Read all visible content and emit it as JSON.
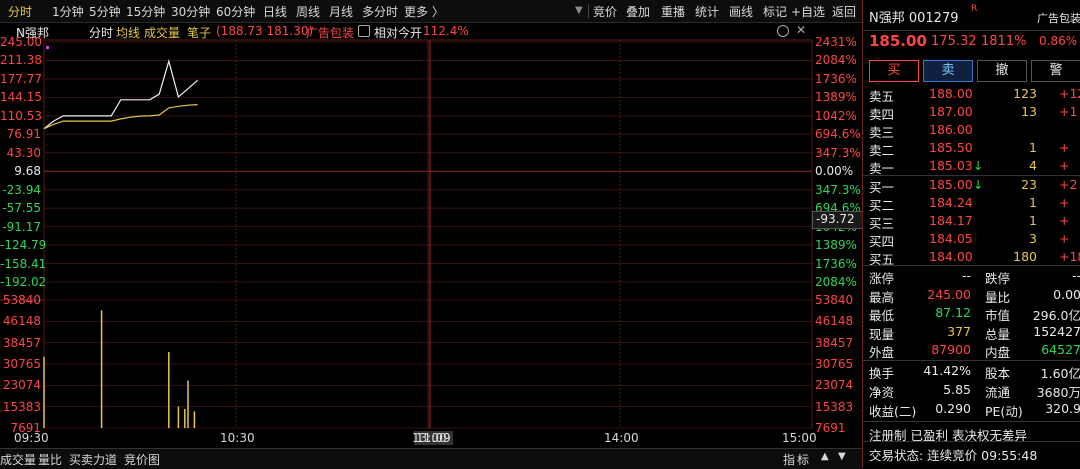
{
  "toolbar": {
    "periods": [
      "分时",
      "1分钟",
      "5分钟",
      "15分钟",
      "30分钟",
      "60分钟",
      "日线",
      "周线",
      "月线",
      "多分时",
      "更多 〉"
    ],
    "actions": [
      "竞价",
      "叠加",
      "重播",
      "统计",
      "画线",
      "标记",
      "+自选",
      "返回"
    ]
  },
  "chart_header": {
    "name": "N强邦",
    "mode": "分时",
    "avg_label": "均线",
    "vol_label": "成交量",
    "pen_label": "笔子",
    "pen_value": "(188.73 181.30)",
    "ad_label": "广告包装",
    "relative_label": "相对今开",
    "relative_value": "112.4%"
  },
  "axis": {
    "left_prices": [
      "245.00",
      "211.38",
      "177.77",
      "144.15",
      "110.53",
      "76.91",
      "43.30",
      "9.68",
      "-23.94",
      "-57.55",
      "-91.17",
      "-124.79",
      "-158.41",
      "-192.02"
    ],
    "right_pcts": [
      "2431%",
      "2084%",
      "1736%",
      "1389%",
      "1042%",
      "694.6%",
      "347.3%",
      "0.00%",
      "347.3%",
      "694.6%",
      "1042%",
      "1389%",
      "1736%",
      "2084%"
    ],
    "cursor_value": "-93.72",
    "vol_ticks": [
      "53840",
      "46148",
      "38457",
      "30765",
      "23074",
      "15383",
      "7691"
    ],
    "time_labels": [
      "09:30",
      "10:30",
      "11:09",
      "13:00",
      "14:00",
      "15:00"
    ]
  },
  "chart_data": {
    "type": "line",
    "series": [
      {
        "x": [
          "09:30",
          "09:33",
          "09:36",
          "09:39",
          "09:42",
          "09:45",
          "09:48",
          "09:51",
          "09:54",
          "09:57",
          "10:00",
          "10:03",
          "10:06",
          "10:09",
          "10:12",
          "10:15",
          "10:18"
        ],
        "values": [
          87.1,
          101.0,
          110.5,
          110.5,
          110.5,
          110.5,
          110.5,
          110.5,
          139.7,
          139.7,
          139.7,
          139.7,
          150.0,
          210.0,
          145.0,
          160.0,
          175.3
        ]
      },
      {
        "x": [
          "09:30",
          "09:33",
          "09:36",
          "09:39",
          "09:42",
          "09:45",
          "09:48",
          "09:51",
          "09:54",
          "09:57",
          "10:00",
          "10:03",
          "10:06",
          "10:09",
          "10:12",
          "10:15",
          "10:18"
        ],
        "values": [
          87.1,
          95.0,
          101.0,
          101.0,
          101.0,
          101.0,
          101.0,
          101.0,
          105.0,
          108.0,
          110.0,
          110.5,
          112.0,
          125.0,
          128.0,
          130.0,
          131.0
        ]
      }
    ],
    "volume": [
      {
        "x": "09:30",
        "v": 30000
      },
      {
        "x": "09:48",
        "v": 49500
      },
      {
        "x": "10:09",
        "v": 32000
      },
      {
        "x": "10:12",
        "v": 9000
      },
      {
        "x": "10:14",
        "v": 8000
      },
      {
        "x": "10:15",
        "v": 20000
      },
      {
        "x": "10:17",
        "v": 7000
      }
    ],
    "ylim": [
      -192.02,
      245.0
    ],
    "vol_max": 53840,
    "xlabel": "",
    "ylabel": ""
  },
  "stock": {
    "title": "N强邦 001279",
    "title_flag": "R",
    "ad": "广告包装",
    "price": "185.00",
    "change": "175.32",
    "pct": "1811%",
    "ad_pct": "0.86%"
  },
  "trade_buttons": [
    "买",
    "卖",
    "撤",
    "警"
  ],
  "sell": [
    {
      "label": "卖五",
      "price": "188.00",
      "vol": "123",
      "chg": "+12"
    },
    {
      "label": "卖四",
      "price": "187.00",
      "vol": "13",
      "chg": "+1"
    },
    {
      "label": "卖三",
      "price": "186.00",
      "vol": "",
      "chg": ""
    },
    {
      "label": "卖二",
      "price": "185.50",
      "vol": "1",
      "chg": "+"
    },
    {
      "label": "卖一",
      "price": "185.03",
      "vol": "4",
      "chg": "+",
      "arrow": "↓"
    }
  ],
  "buy": [
    {
      "label": "买一",
      "price": "185.00",
      "vol": "23",
      "chg": "+2",
      "arrow": "↓"
    },
    {
      "label": "买二",
      "price": "184.24",
      "vol": "1",
      "chg": "+"
    },
    {
      "label": "买三",
      "price": "184.17",
      "vol": "1",
      "chg": "+"
    },
    {
      "label": "买四",
      "price": "184.05",
      "vol": "3",
      "chg": "+"
    },
    {
      "label": "买五",
      "price": "184.00",
      "vol": "180",
      "chg": "+18"
    }
  ],
  "stats1": [
    {
      "k1": "涨停",
      "v1": "--",
      "k2": "跌停",
      "v2": "--"
    },
    {
      "k1": "最高",
      "v1": "245.00",
      "k2": "量比",
      "v2": "0.00"
    },
    {
      "k1": "最低",
      "v1": "87.12",
      "k2": "市值",
      "v2": "296.0亿"
    },
    {
      "k1": "现量",
      "v1": "377",
      "k2": "总量",
      "v2": "152427"
    },
    {
      "k1": "外盘",
      "v1": "87900",
      "k2": "内盘",
      "v2": "64527"
    }
  ],
  "stats2": [
    {
      "k1": "换手",
      "v1": "41.42%",
      "k2": "股本",
      "v2": "1.60亿"
    },
    {
      "k1": "净资",
      "v1": "5.85",
      "k2": "流通",
      "v2": "3680万"
    },
    {
      "k1": "收益(二)",
      "v1": "0.290",
      "k2": "PE(动)",
      "v2": "320.9"
    }
  ],
  "notice": "注册制 已盈利 表决权无差异",
  "status": "交易状态: 连续竞价 09:55:48",
  "bottom_tabs": [
    "成交量",
    "量比",
    "买卖力道",
    "竞价图"
  ],
  "bottom_right": [
    "指",
    "标"
  ]
}
